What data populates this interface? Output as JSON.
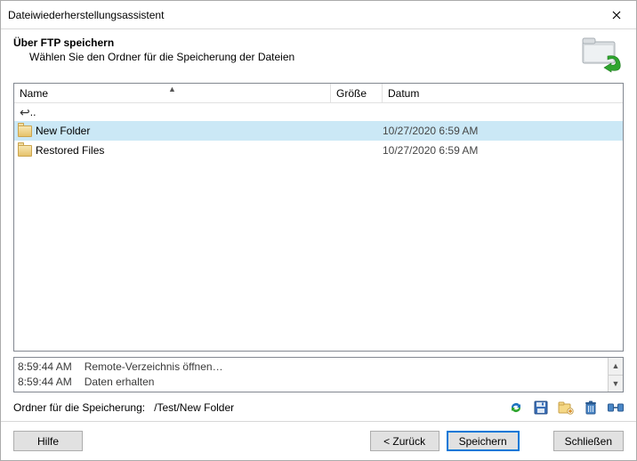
{
  "window": {
    "title": "Dateiwiederherstellungsassistent"
  },
  "header": {
    "title": "Über FTP speichern",
    "subtitle": "Wählen Sie den Ordner für die Speicherung der Dateien"
  },
  "columns": {
    "name": "Name",
    "size": "Größe",
    "date": "Datum"
  },
  "up": {
    "label": ".."
  },
  "rows": [
    {
      "name": "New Folder",
      "size": "",
      "date": "10/27/2020 6:59 AM",
      "selected": true
    },
    {
      "name": "Restored Files",
      "size": "",
      "date": "10/27/2020 6:59 AM",
      "selected": false
    }
  ],
  "log": [
    {
      "time": "8:59:44 AM",
      "msg": "Remote-Verzeichnis öffnen…"
    },
    {
      "time": "8:59:44 AM",
      "msg": "Daten erhalten"
    }
  ],
  "path": {
    "label": "Ordner für die Speicherung:",
    "value": "/Test/New Folder"
  },
  "buttons": {
    "help": "Hilfe",
    "back": "< Zurück",
    "save": "Speichern",
    "close": "Schließen"
  }
}
